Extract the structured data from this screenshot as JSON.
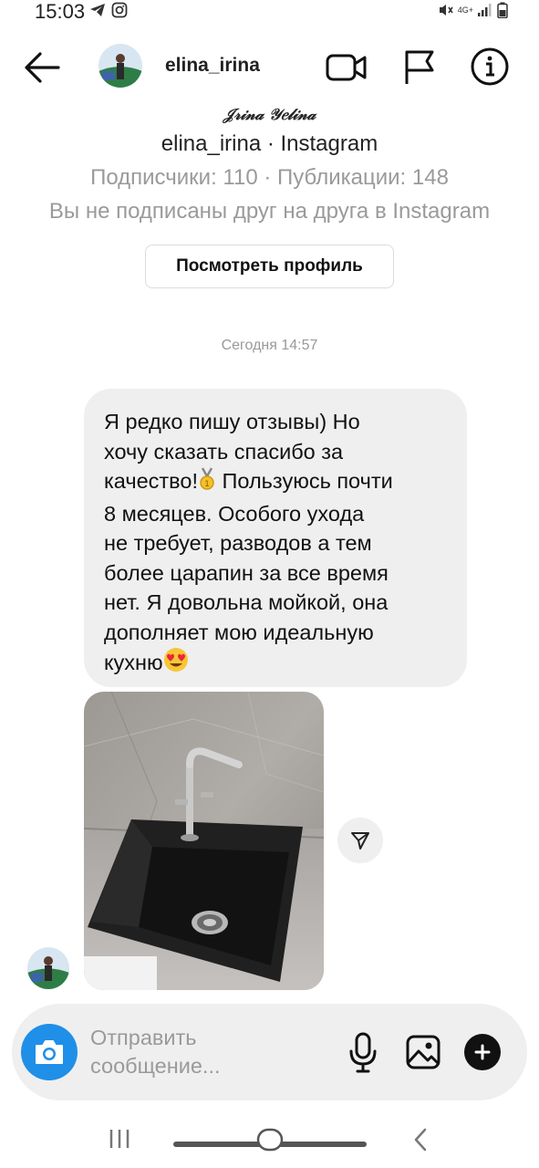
{
  "status_bar": {
    "time": "15:03",
    "left_icons": [
      "telegram-icon",
      "instagram-icon"
    ],
    "right_icons": [
      "mute-icon",
      "network-4g-icon",
      "signal-icon",
      "battery-icon"
    ],
    "network_label": "4G+"
  },
  "header": {
    "username": "elina_irina",
    "icons": [
      "back-arrow-icon",
      "video-call-icon",
      "flag-icon",
      "info-icon"
    ]
  },
  "profile": {
    "fullname": "𝒥𝓇𝒾𝓃𝒶 𝒴𝑒𝓁𝒾𝓃𝒶",
    "subtitle": "elina_irina · Instagram",
    "stats": "Подписчики: 110 · Публикации: 148",
    "follow_status": "Вы не подписаны друг на друга в Instagram",
    "view_profile_label": "Посмотреть профиль"
  },
  "thread": {
    "timestamp": "Сегодня 14:57",
    "message": {
      "line1": "Я редко пишу отзывы) Но\nхочу сказать спасибо за\nкачество!",
      "emoji1": "🏅",
      "line2": " Пользуюсь почти\n8 месяцев. Особого ухода\nне требует, разводов а тем\nболее царапин за все время\nнет. Я довольна мойкой, она\nдополняет мою идеальную\nкухню",
      "emoji2": "😍"
    },
    "photo_description_icon": "sink-photo"
  },
  "composer": {
    "placeholder": "Отправить\nсообщение...",
    "icons": [
      "camera-icon",
      "microphone-icon",
      "gallery-icon",
      "add-sticker-icon"
    ]
  },
  "colors": {
    "accent": "#1f8fe8",
    "bubble": "#efefef",
    "muted_text": "#9a9a9a"
  }
}
